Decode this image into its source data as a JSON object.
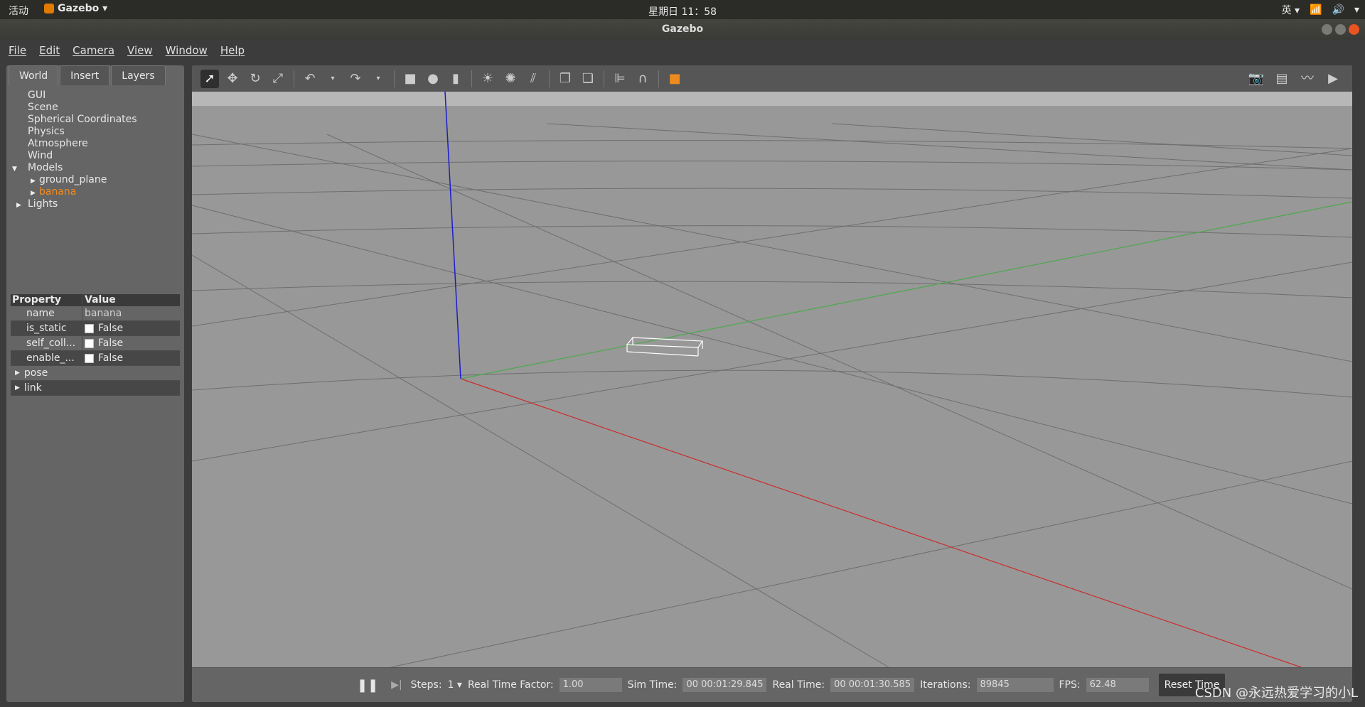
{
  "topbar": {
    "activities": "活动",
    "app_name": "Gazebo ▾",
    "clock": "星期日 11：58",
    "ime": "英 ▾"
  },
  "window": {
    "title": "Gazebo"
  },
  "menu": {
    "file": "File",
    "edit": "Edit",
    "camera": "Camera",
    "view": "View",
    "window": "Window",
    "help": "Help"
  },
  "left_panel": {
    "tabs": {
      "world": "World",
      "insert": "Insert",
      "layers": "Layers"
    },
    "tree": {
      "gui": "GUI",
      "scene": "Scene",
      "spherical": "Spherical Coordinates",
      "physics": "Physics",
      "atmosphere": "Atmosphere",
      "wind": "Wind",
      "models": "Models",
      "ground_plane": "ground_plane",
      "banana": "banana",
      "lights": "Lights"
    },
    "props": {
      "header_property": "Property",
      "header_value": "Value",
      "name_key": "name",
      "name_val": "banana",
      "is_static_key": "is_static",
      "is_static_val": "False",
      "self_coll_key": "self_coll...",
      "self_coll_val": "False",
      "enable_key": "enable_...",
      "enable_val": "False",
      "pose": "pose",
      "link": "link"
    }
  },
  "status": {
    "steps_label": "Steps:",
    "steps_val": "1 ▾",
    "rtf_label": "Real Time Factor:",
    "rtf_val": "1.00",
    "sim_label": "Sim Time:",
    "sim_val": "00 00:01:29.845",
    "real_label": "Real Time:",
    "real_val": "00 00:01:30.585",
    "iter_label": "Iterations:",
    "iter_val": "89845",
    "fps_label": "FPS:",
    "fps_val": "62.48",
    "reset": "Reset Time"
  },
  "watermark": "CSDN @永远热爱学习的小L"
}
